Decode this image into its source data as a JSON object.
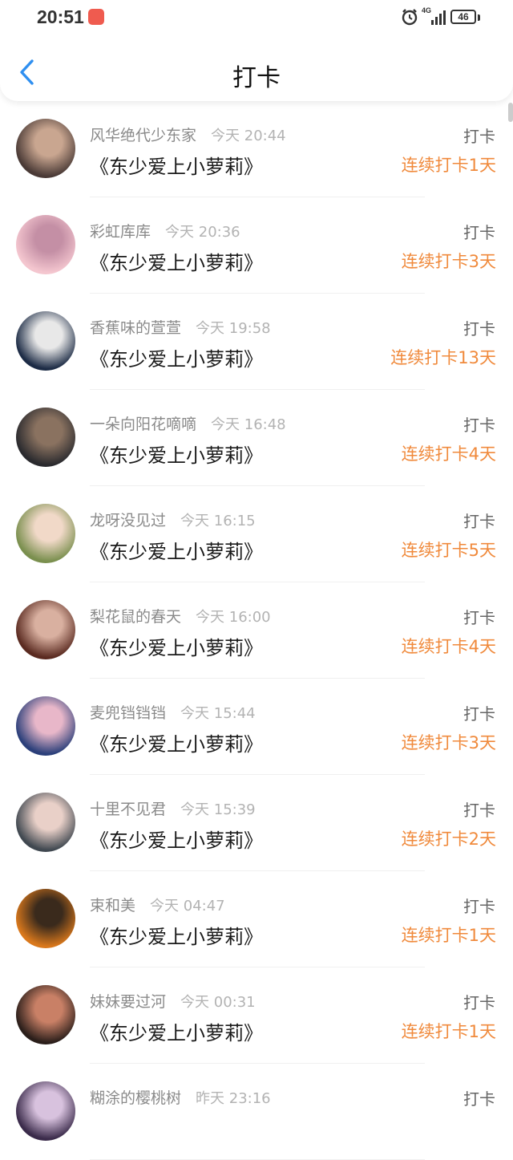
{
  "status_bar": {
    "time": "20:51",
    "network": "4G",
    "battery": "46"
  },
  "header": {
    "title": "打卡"
  },
  "colors": {
    "streak": "#f08a3c",
    "back_arrow": "#2f8ff0"
  },
  "entries": [
    {
      "name": "风华绝代少东家",
      "time": "今天 20:44",
      "book": "《东少爱上小萝莉》",
      "action": "打卡",
      "streak": "连续打卡1天"
    },
    {
      "name": "彩虹库库",
      "time": "今天 20:36",
      "book": "《东少爱上小萝莉》",
      "action": "打卡",
      "streak": "连续打卡3天"
    },
    {
      "name": "香蕉味的萱萱",
      "time": "今天 19:58",
      "book": "《东少爱上小萝莉》",
      "action": "打卡",
      "streak": "连续打卡13天"
    },
    {
      "name": "一朵向阳花嘀嘀",
      "time": "今天 16:48",
      "book": "《东少爱上小萝莉》",
      "action": "打卡",
      "streak": "连续打卡4天"
    },
    {
      "name": "龙呀没见过",
      "time": "今天 16:15",
      "book": "《东少爱上小萝莉》",
      "action": "打卡",
      "streak": "连续打卡5天"
    },
    {
      "name": "梨花鼠的春天",
      "time": "今天 16:00",
      "book": "《东少爱上小萝莉》",
      "action": "打卡",
      "streak": "连续打卡4天"
    },
    {
      "name": "麦兜铛铛铛",
      "time": "今天 15:44",
      "book": "《东少爱上小萝莉》",
      "action": "打卡",
      "streak": "连续打卡3天"
    },
    {
      "name": "十里不见君",
      "time": "今天 15:39",
      "book": "《东少爱上小萝莉》",
      "action": "打卡",
      "streak": "连续打卡2天"
    },
    {
      "name": "束和美",
      "time": "今天 04:47",
      "book": "《东少爱上小萝莉》",
      "action": "打卡",
      "streak": "连续打卡1天"
    },
    {
      "name": "妹妹要过河",
      "time": "今天 00:31",
      "book": "《东少爱上小萝莉》",
      "action": "打卡",
      "streak": "连续打卡1天"
    },
    {
      "name": "糊涂的樱桃树",
      "time": "昨天 23:16",
      "book": "",
      "action": "打卡",
      "streak": ""
    }
  ]
}
